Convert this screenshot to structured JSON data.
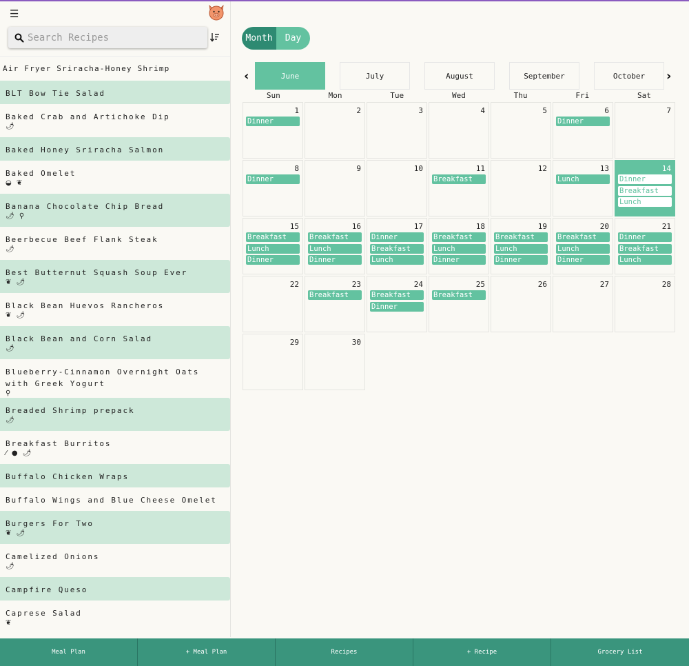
{
  "sidebar": {
    "search_placeholder": "Search Recipes",
    "first_recipe": "Air Fryer Sriracha-Honey Shrimp",
    "recipes": [
      {
        "name": "BLT Bow Tie Salad",
        "icons": ""
      },
      {
        "name": "Baked Crab and Artichoke Dip",
        "icons": "🌶"
      },
      {
        "name": "Baked Honey Sriracha Salmon",
        "icons": ""
      },
      {
        "name": "Baked Omelet",
        "icons": "◒ ❦"
      },
      {
        "name": "Banana Chocolate Chip Bread",
        "icons": "🌶 ⚲"
      },
      {
        "name": "Beerbecue Beef Flank Steak",
        "icons": "🌶"
      },
      {
        "name": "Best Butternut Squash Soup Ever",
        "icons": "❦ 🌶"
      },
      {
        "name": "Black Bean Huevos Rancheros",
        "icons": "❦ 🌶"
      },
      {
        "name": "Black Bean and Corn Salad",
        "icons": "🌶"
      },
      {
        "name": "Blueberry-Cinnamon Overnight Oats with Greek Yogurt",
        "icons": "⚲"
      },
      {
        "name": "Breaded Shrimp prepack",
        "icons": "🌶"
      },
      {
        "name": "Breakfast Burritos",
        "icons": "⁄ ● 🌶"
      },
      {
        "name": "Buffalo Chicken Wraps",
        "icons": ""
      },
      {
        "name": "Buffalo Wings and Blue Cheese Omelet",
        "icons": ""
      },
      {
        "name": "Burgers For Two",
        "icons": "❦ 🌶"
      },
      {
        "name": "Camelized Onions",
        "icons": "🌶"
      },
      {
        "name": "Campfire Queso",
        "icons": ""
      },
      {
        "name": "Caprese Salad",
        "icons": "❦"
      }
    ]
  },
  "view_toggle": {
    "month": "Month",
    "day": "Day"
  },
  "months": [
    "June",
    "July",
    "August",
    "September",
    "October"
  ],
  "active_month": "June",
  "weekdays": [
    "Sun",
    "Mon",
    "Tue",
    "Wed",
    "Thu",
    "Fri",
    "Sat"
  ],
  "calendar": {
    "first_weekday_index": 0,
    "today": 14,
    "days": [
      {
        "day": 1,
        "events": [
          "Dinner"
        ]
      },
      {
        "day": 2,
        "events": []
      },
      {
        "day": 3,
        "events": []
      },
      {
        "day": 4,
        "events": []
      },
      {
        "day": 5,
        "events": []
      },
      {
        "day": 6,
        "events": [
          "Dinner"
        ]
      },
      {
        "day": 7,
        "events": []
      },
      {
        "day": 8,
        "events": [
          "Dinner"
        ]
      },
      {
        "day": 9,
        "events": []
      },
      {
        "day": 10,
        "events": []
      },
      {
        "day": 11,
        "events": [
          "Breakfast"
        ]
      },
      {
        "day": 12,
        "events": []
      },
      {
        "day": 13,
        "events": [
          "Lunch"
        ]
      },
      {
        "day": 14,
        "events": [
          "Dinner",
          "Breakfast",
          "Lunch"
        ]
      },
      {
        "day": 15,
        "events": [
          "Breakfast",
          "Lunch",
          "Dinner"
        ]
      },
      {
        "day": 16,
        "events": [
          "Breakfast",
          "Lunch",
          "Dinner"
        ]
      },
      {
        "day": 17,
        "events": [
          "Dinner",
          "Breakfast",
          "Lunch"
        ]
      },
      {
        "day": 18,
        "events": [
          "Breakfast",
          "Lunch",
          "Dinner"
        ]
      },
      {
        "day": 19,
        "events": [
          "Breakfast",
          "Lunch",
          "Dinner"
        ]
      },
      {
        "day": 20,
        "events": [
          "Breakfast",
          "Lunch",
          "Dinner"
        ]
      },
      {
        "day": 21,
        "events": [
          "Dinner",
          "Breakfast",
          "Lunch"
        ]
      },
      {
        "day": 22,
        "events": []
      },
      {
        "day": 23,
        "events": [
          "Breakfast"
        ]
      },
      {
        "day": 24,
        "events": [
          "Breakfast",
          "Dinner"
        ]
      },
      {
        "day": 25,
        "events": [
          "Breakfast"
        ]
      },
      {
        "day": 26,
        "events": []
      },
      {
        "day": 27,
        "events": []
      },
      {
        "day": 28,
        "events": []
      },
      {
        "day": 29,
        "events": []
      },
      {
        "day": 30,
        "events": []
      }
    ]
  },
  "bottom_nav": [
    "Meal Plan",
    "+ Meal Plan",
    "Recipes",
    "+ Recipe",
    "Grocery List"
  ],
  "colors": {
    "accent": "#63c2a0",
    "accent_dark": "#2e8a72",
    "bottom_bar": "#3a957d",
    "alt_row": "#cde8d9",
    "background": "#faf9f4"
  }
}
